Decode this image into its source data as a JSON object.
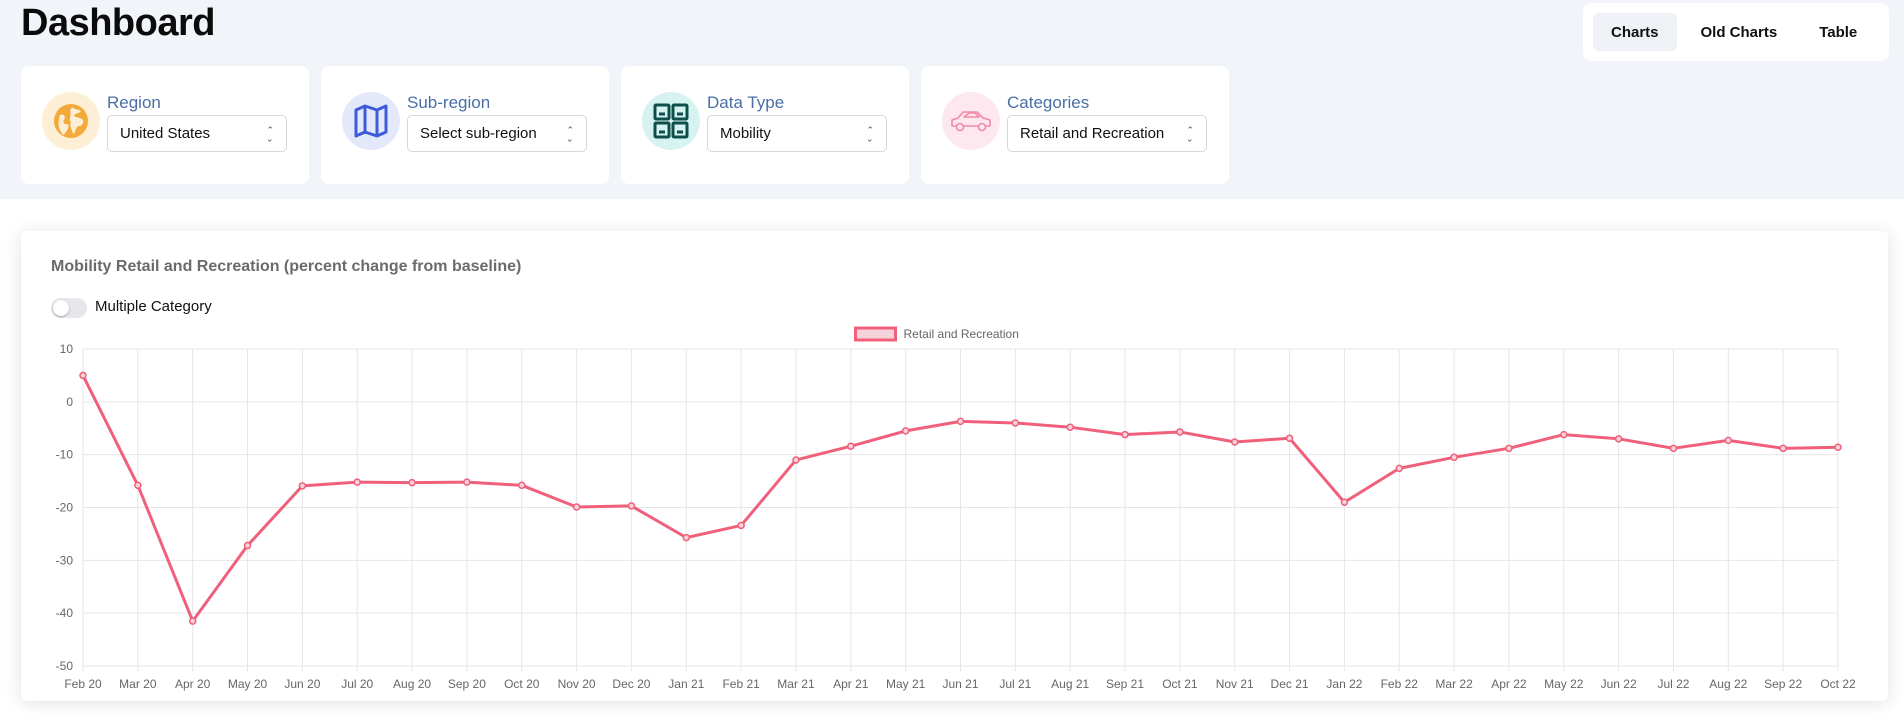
{
  "header": {
    "title": "Dashboard"
  },
  "view_tabs": [
    {
      "label": "Charts",
      "active": true
    },
    {
      "label": "Old Charts",
      "active": false
    },
    {
      "label": "Table",
      "active": false
    }
  ],
  "filters": {
    "region": {
      "label": "Region",
      "value": "United States",
      "icon": "globe-icon",
      "icon_color": "#f4a93b",
      "icon_bg": "#fdefd6"
    },
    "subregion": {
      "label": "Sub-region",
      "value": "Select sub-region",
      "icon": "map-icon",
      "icon_color": "#3b5bdb",
      "icon_bg": "#e3e8fb"
    },
    "data_type": {
      "label": "Data Type",
      "value": "Mobility",
      "icon": "grid-icon",
      "icon_color": "#0d4f4a",
      "icon_bg": "#d6f3f1"
    },
    "categories": {
      "label": "Categories",
      "value": "Retail and Recreation",
      "icon": "car-icon",
      "icon_color": "#f18aa8",
      "icon_bg": "#fde8ef"
    }
  },
  "chart_section": {
    "title": "Mobility Retail and Recreation (percent change from baseline)",
    "toggle_label": "Multiple Category",
    "toggle_on": false
  },
  "chart_data": {
    "type": "line",
    "categories": [
      "Feb 20",
      "Mar 20",
      "Apr 20",
      "May 20",
      "Jun 20",
      "Jul 20",
      "Aug 20",
      "Sep 20",
      "Oct 20",
      "Nov 20",
      "Dec 20",
      "Jan 21",
      "Feb 21",
      "Mar 21",
      "Apr 21",
      "May 21",
      "Jun 21",
      "Jul 21",
      "Aug 21",
      "Sep 21",
      "Oct 21",
      "Nov 21",
      "Dec 21",
      "Jan 22",
      "Feb 22",
      "Mar 22",
      "Apr 22",
      "May 22",
      "Jun 22",
      "Jul 22",
      "Aug 22",
      "Sep 22",
      "Oct 22"
    ],
    "series": [
      {
        "name": "Retail and Recreation",
        "color": "#f0607a",
        "values": [
          5,
          -15.8,
          -41.5,
          -27.2,
          -15.9,
          -15.2,
          -15.3,
          -15.2,
          -15.8,
          -19.9,
          -19.7,
          -25.7,
          -23.4,
          -11,
          -8.4,
          -5.5,
          -3.7,
          -4,
          -4.8,
          -6.2,
          -5.7,
          -7.6,
          -6.9,
          -19,
          -12.6,
          -10.5,
          -8.8,
          -6.2,
          -7,
          -8.8,
          -7.3,
          -8.8,
          -8.6
        ]
      }
    ],
    "ylim": [
      -50,
      10
    ],
    "yticks": [
      10,
      0,
      -10,
      -20,
      -30,
      -40,
      -50
    ],
    "legend_position": "top",
    "grid": true
  }
}
